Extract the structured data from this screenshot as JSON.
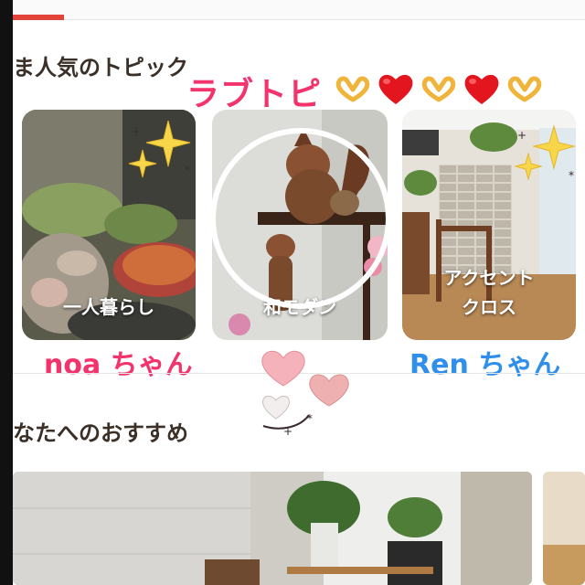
{
  "top_bar": {
    "active_tab_color": "#e3443a"
  },
  "sections": {
    "popular_title": "ま人気のトピック",
    "recommend_title": "なたへのおすすめ"
  },
  "stickers": {
    "love_label": "ラブトピ",
    "emoji_sequence": [
      "heart-hands",
      "red-heart",
      "heart-hands",
      "red-heart",
      "heart-hands"
    ],
    "name_left": "noa ちゃん",
    "name_right": "Ren ちゃん",
    "pink_color": "#f3336c",
    "blue_color": "#2f8fea"
  },
  "topics": [
    {
      "label": "一人暮らし"
    },
    {
      "label": "和モダン"
    },
    {
      "label": "アクセント\nクロス"
    }
  ]
}
